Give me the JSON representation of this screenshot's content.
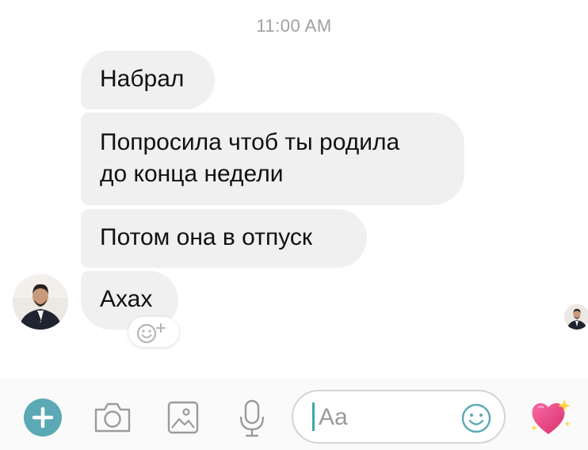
{
  "timestamp": "11:00 AM",
  "messages": [
    {
      "text": "Набрал"
    },
    {
      "lines": [
        "Попросила чтоб ты родила",
        "до конца недели"
      ]
    },
    {
      "text": "Потом она в отпуск"
    },
    {
      "text": "Ахах"
    }
  ],
  "composer": {
    "placeholder": "Aa",
    "icons": [
      "plus-icon",
      "camera-icon",
      "image-icon",
      "microphone-icon",
      "emoji-icon",
      "sparkling-heart-icon"
    ]
  },
  "colors": {
    "bubble": "#f0f0f0",
    "accent": "#3fa6a8",
    "plus_button": "#5aa9b5",
    "heart": "#e8407b"
  }
}
